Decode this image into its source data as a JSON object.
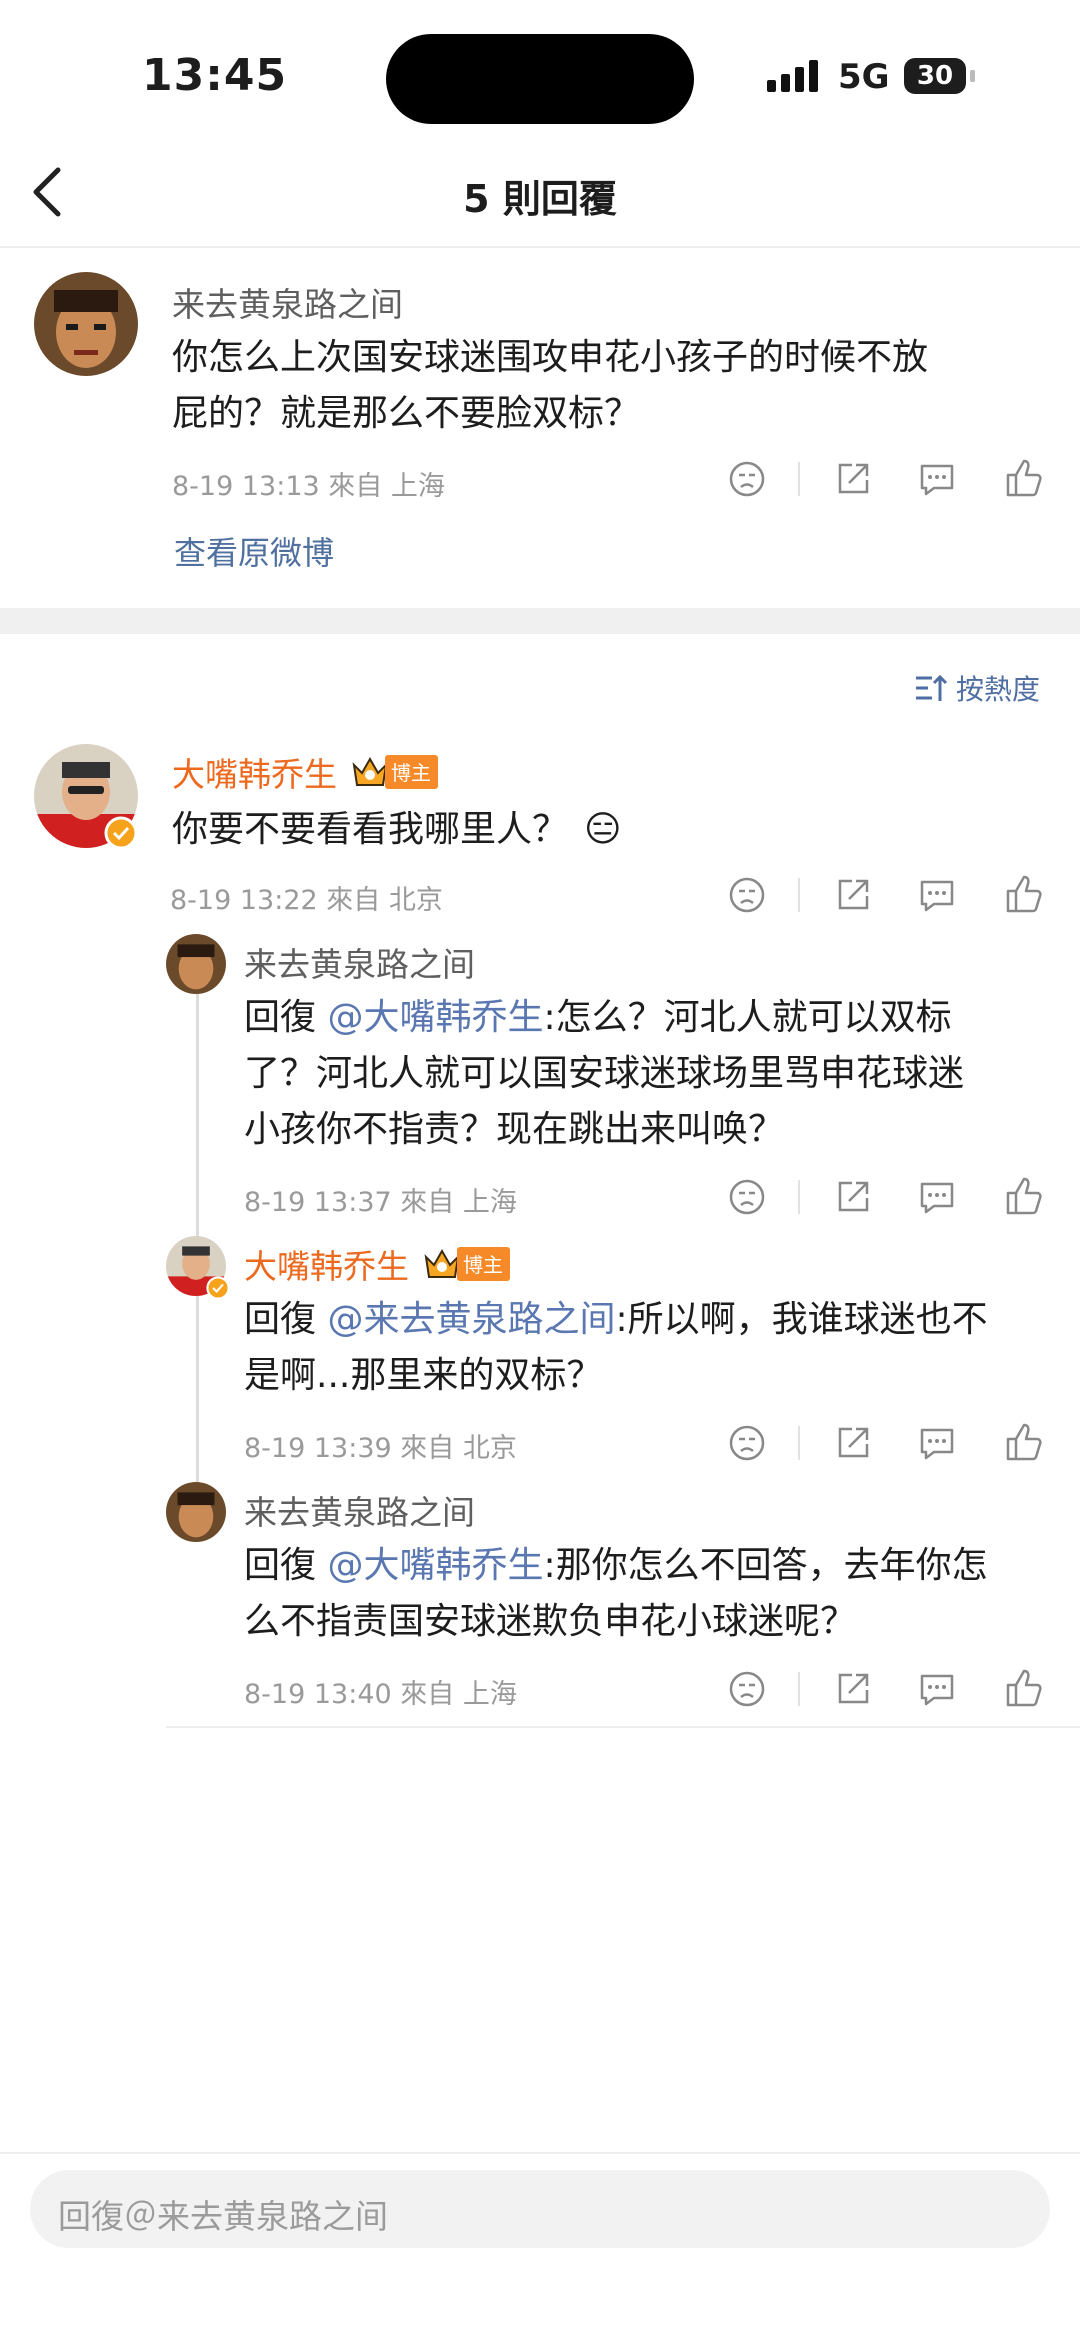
{
  "status": {
    "time": "13:45",
    "network": "5G",
    "battery": "30"
  },
  "nav": {
    "title": "5 則回覆"
  },
  "root": {
    "user": "来去黄泉路之间",
    "text_line1": "你怎么上次国安球迷围攻申花小孩子的时候不放",
    "text_line2": "屁的？就是那么不要脸双标？",
    "meta": "8-19 13:13 來自 上海",
    "view_original": "查看原微博"
  },
  "sort_label": "按熱度",
  "comments": [
    {
      "user": "大嘴韩乔生",
      "badge": "博主",
      "text": "你要不要看看我哪里人？",
      "emoji": "😑",
      "meta": "8-19 13:22 來自 北京"
    }
  ],
  "replies": [
    {
      "user": "来去黄泉路之间",
      "prefix": "回復 ",
      "mention": "@大嘴韩乔生",
      "line1_rest": ":怎么？河北人就可以双标",
      "line2": "了？河北人就可以国安球迷球场里骂申花球迷",
      "line3": "小孩你不指责？现在跳出来叫唤？",
      "meta": "8-19 13:37 來自 上海"
    },
    {
      "user": "大嘴韩乔生",
      "badge": "博主",
      "prefix": "回復 ",
      "mention": "@来去黄泉路之间",
      "line1_rest": ":所以啊，我谁球迷也不",
      "line2": "是啊...那里来的双标？",
      "meta": "8-19 13:39 來自 北京"
    },
    {
      "user": "来去黄泉路之间",
      "prefix": "回復 ",
      "mention": "@大嘴韩乔生",
      "line1_rest": ":那你怎么不回答，去年你怎",
      "line2": "么不指责国安球迷欺负申花小球迷呢？",
      "meta": "8-19 13:40 來自 上海"
    }
  ],
  "input": {
    "placeholder": "回復＠来去黄泉路之间"
  },
  "colors": {
    "accent_orange": "#ec6a1f",
    "mention_blue": "#5a77b2",
    "badge_orange": "#f68a28"
  }
}
